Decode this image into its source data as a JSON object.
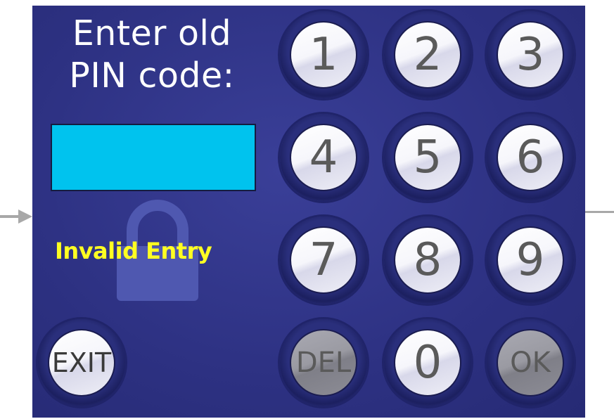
{
  "prompt": {
    "line1": "Enter old",
    "line2": "PIN code:"
  },
  "pin_field": {
    "value": ""
  },
  "status": {
    "text": "Invalid Entry",
    "color": "#ffff22"
  },
  "keypad": {
    "k1": "1",
    "k2": "2",
    "k3": "3",
    "k4": "4",
    "k5": "5",
    "k6": "6",
    "k7": "7",
    "k8": "8",
    "k9": "9",
    "k0": "0",
    "del": "DEL",
    "ok": "OK",
    "exit": "EXIT"
  },
  "colors": {
    "panel_bg": "#2d3182",
    "pin_field_bg": "#00c3ee",
    "lock_icon": "#4f58b0"
  },
  "icons": {
    "lock": "padlock-icon",
    "arrow_in": "arrow-right-icon"
  }
}
